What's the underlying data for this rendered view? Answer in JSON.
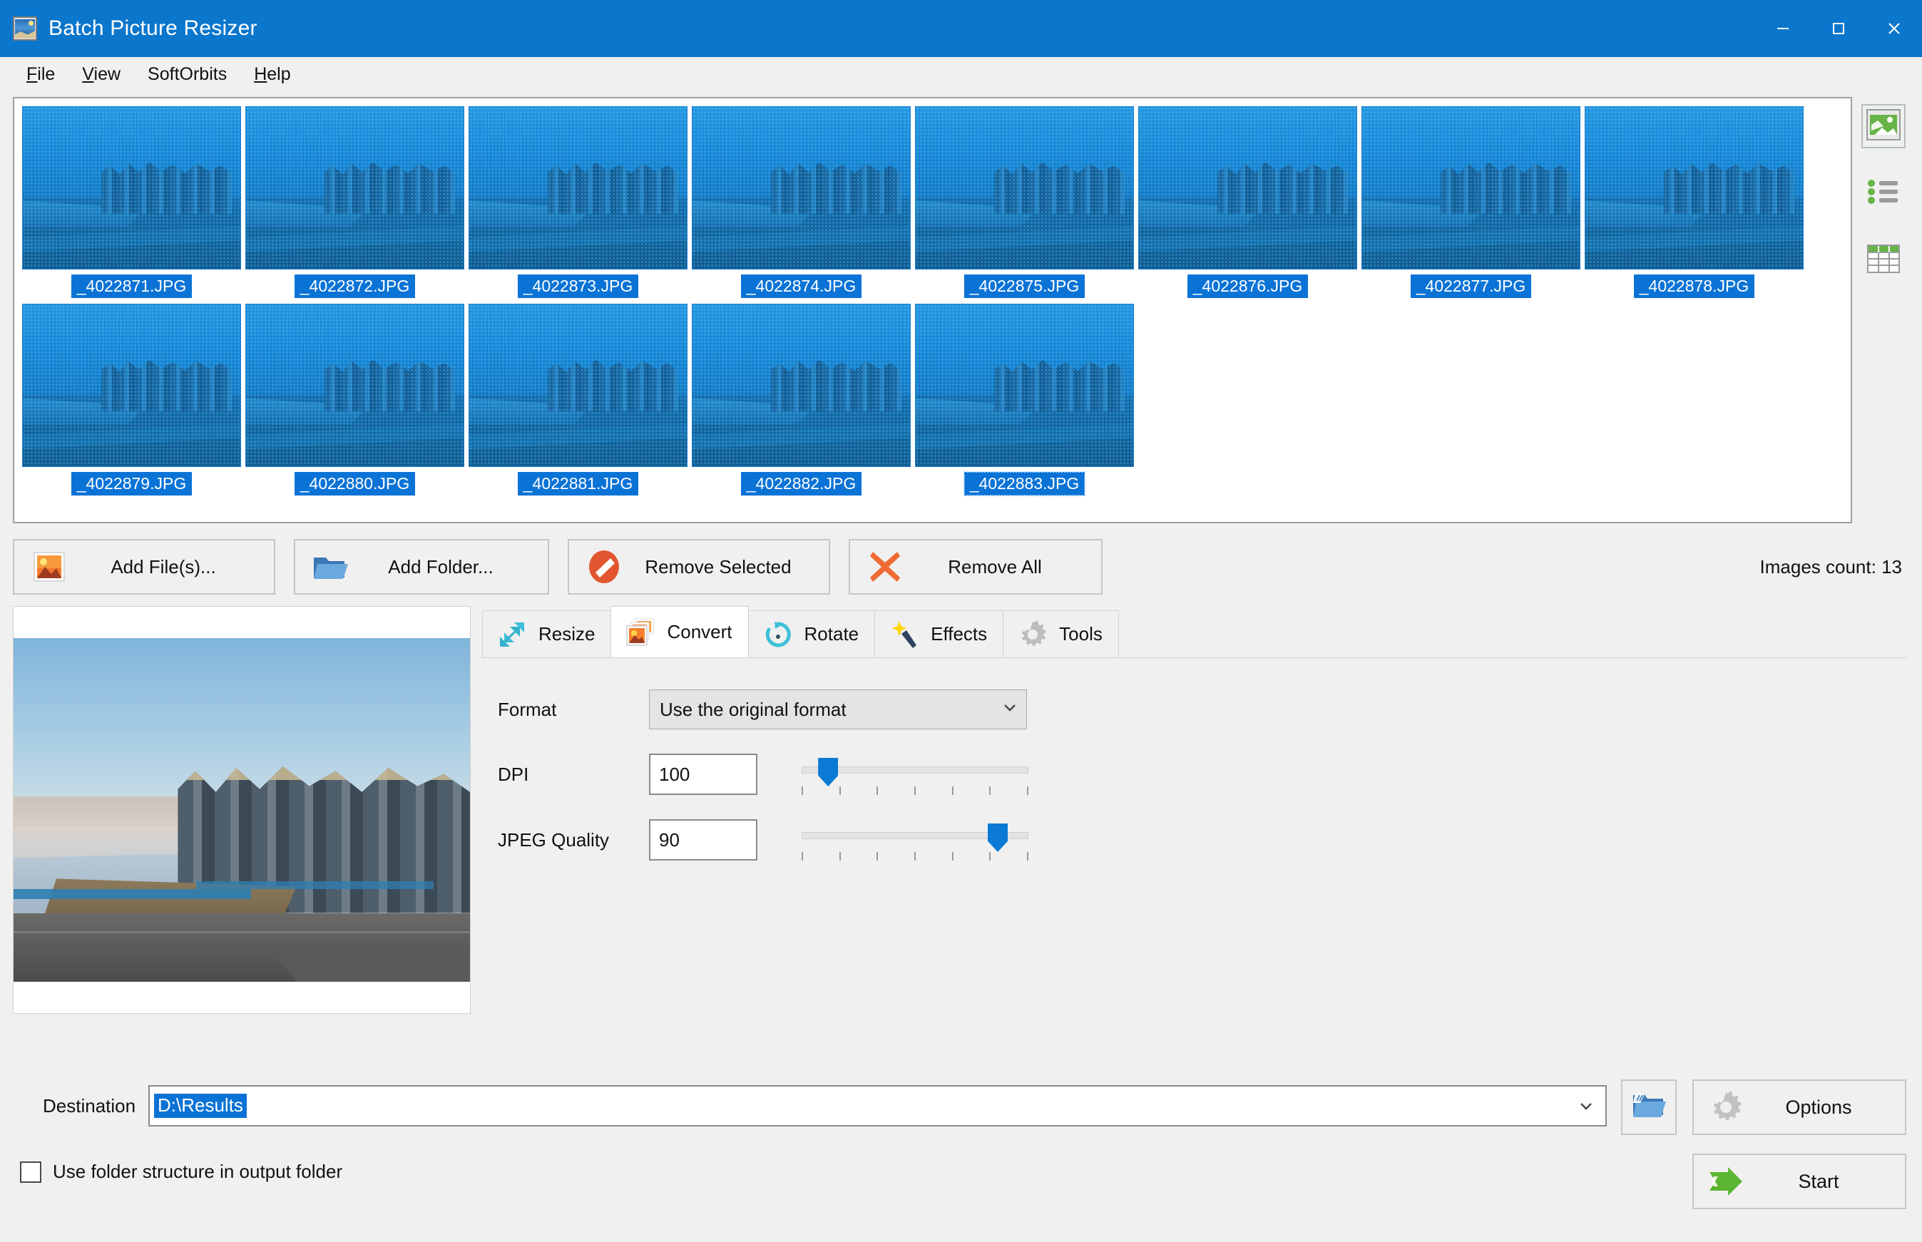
{
  "window": {
    "title": "Batch Picture Resizer",
    "app_icon": "app-picture-icon",
    "controls": {
      "minimize": "minimize-icon",
      "maximize": "maximize-icon",
      "close": "close-icon"
    },
    "titlebar_color": "#0a76cc"
  },
  "menu": [
    {
      "label": "File",
      "accel": "F"
    },
    {
      "label": "View",
      "accel": "V"
    },
    {
      "label": "SoftOrbits",
      "accel": ""
    },
    {
      "label": "Help",
      "accel": "H"
    }
  ],
  "thumbnails": {
    "items": [
      {
        "filename": "_4022871.JPG",
        "selected": true,
        "focused": false
      },
      {
        "filename": "_4022872.JPG",
        "selected": true,
        "focused": false
      },
      {
        "filename": "_4022873.JPG",
        "selected": true,
        "focused": false
      },
      {
        "filename": "_4022874.JPG",
        "selected": true,
        "focused": false
      },
      {
        "filename": "_4022875.JPG",
        "selected": true,
        "focused": false
      },
      {
        "filename": "_4022876.JPG",
        "selected": true,
        "focused": false
      },
      {
        "filename": "_4022877.JPG",
        "selected": true,
        "focused": false
      },
      {
        "filename": "_4022878.JPG",
        "selected": true,
        "focused": false
      },
      {
        "filename": "_4022879.JPG",
        "selected": true,
        "focused": false
      },
      {
        "filename": "_4022880.JPG",
        "selected": true,
        "focused": false
      },
      {
        "filename": "_4022881.JPG",
        "selected": true,
        "focused": false
      },
      {
        "filename": "_4022882.JPG",
        "selected": true,
        "focused": false
      },
      {
        "filename": "_4022883.JPG",
        "selected": true,
        "focused": true
      }
    ],
    "selection_color": "#0b73d6"
  },
  "view_modes": [
    {
      "name": "thumbnail-view",
      "icon": "image-thumbnail-icon",
      "active": true
    },
    {
      "name": "list-view",
      "icon": "bullet-list-icon",
      "active": false
    },
    {
      "name": "details-view",
      "icon": "table-grid-icon",
      "active": false
    }
  ],
  "actions": {
    "add_files": {
      "label": "Add File(s)...",
      "accel": "l",
      "icon": "add-image-icon"
    },
    "add_folder": {
      "label": "Add Folder...",
      "accel": "o",
      "icon": "folder-open-icon"
    },
    "remove_selected": {
      "label": "Remove Selected",
      "accel": "S",
      "icon": "no-entry-icon"
    },
    "remove_all": {
      "label": "Remove All",
      "accel": "A",
      "icon": "red-x-icon"
    },
    "images_count": "Images count: 13"
  },
  "tabs": [
    {
      "label": "Resize",
      "icon": "resize-arrows-icon",
      "active": false
    },
    {
      "label": "Convert",
      "icon": "convert-images-icon",
      "active": true
    },
    {
      "label": "Rotate",
      "icon": "rotate-arrow-icon",
      "active": false
    },
    {
      "label": "Effects",
      "icon": "magic-wand-icon",
      "active": false
    },
    {
      "label": "Tools",
      "icon": "gear-tools-icon",
      "active": false
    }
  ],
  "convert_panel": {
    "format": {
      "label": "Format",
      "value": "Use the original format",
      "chevron": "chevron-down-icon"
    },
    "dpi": {
      "label": "DPI",
      "value": "100",
      "slider_percent": 8,
      "tick_count": 7
    },
    "jpeg_quality": {
      "label": "JPEG Quality",
      "value": "90",
      "slider_percent": 90,
      "tick_count": 7
    }
  },
  "preview": {
    "name": "image-preview",
    "alt": "cityscape-with-towers-and-frozen-river"
  },
  "bottom": {
    "destination": {
      "label": "Destination",
      "value": "D:\\Results",
      "selected": true,
      "chevron": "chevron-down-icon"
    },
    "use_folder_structure": {
      "label": "Use folder structure in output folder",
      "checked": false
    },
    "browse": {
      "icon": "browse-folder-icon"
    },
    "options": {
      "label": "Options",
      "icon": "gear-icon"
    },
    "start": {
      "label": "Start",
      "icon": "green-arrow-icon"
    }
  }
}
